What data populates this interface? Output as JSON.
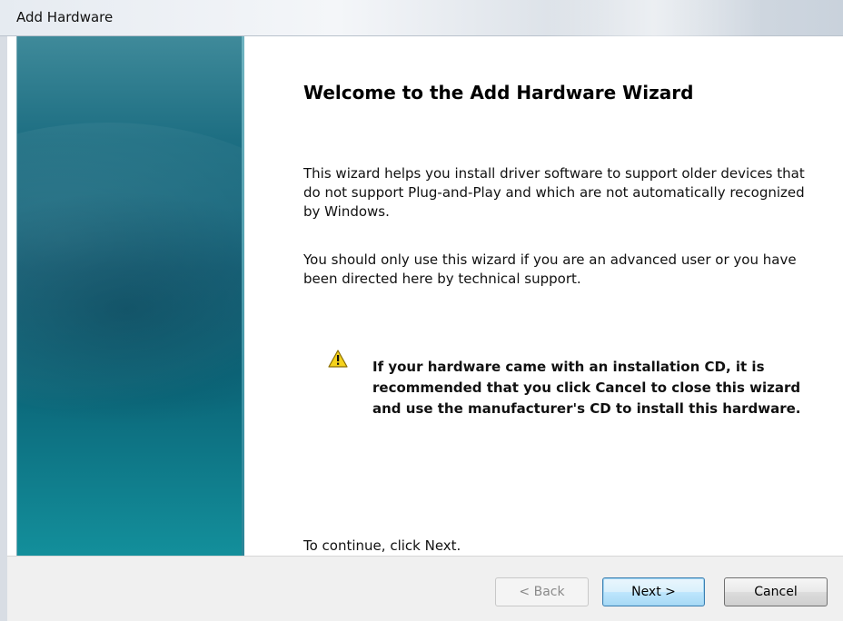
{
  "window": {
    "title": "Add Hardware"
  },
  "wizard": {
    "heading": "Welcome to the Add Hardware Wizard",
    "paragraph1": "This wizard helps you install driver software to support older devices that do not support Plug-and-Play and which are not automatically recognized by Windows.",
    "paragraph2": "You should only use this wizard if you are an advanced user or you have been directed here by technical support.",
    "warning_icon": "warning-triangle-icon",
    "warning_text": "If your hardware came with an installation CD, it is recommended that you click Cancel to close this wizard and use the manufacturer's CD to install this hardware.",
    "continue_text": "To continue, click Next."
  },
  "buttons": {
    "back": "< Back",
    "next": "Next >",
    "cancel": "Cancel"
  },
  "colors": {
    "side_panel": "#0f5f76",
    "warning_yellow": "#f5d21c"
  }
}
